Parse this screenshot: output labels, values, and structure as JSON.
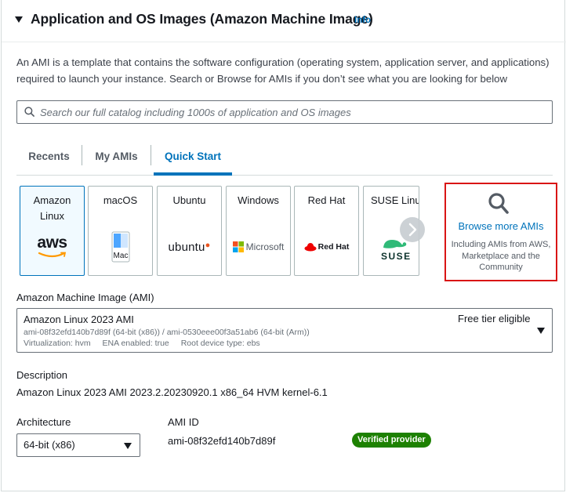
{
  "header": {
    "title": "Application and OS Images (Amazon Machine Image)",
    "info_label": "Info"
  },
  "description": "An AMI is a template that contains the software configuration (operating system, application server, and applications) required to launch your instance. Search or Browse for AMIs if you don’t see what you are looking for below",
  "search": {
    "placeholder": "Search our full catalog including 1000s of application and OS images"
  },
  "tabs": [
    {
      "label": "Recents",
      "active": false
    },
    {
      "label": "My AMIs",
      "active": false
    },
    {
      "label": "Quick Start",
      "active": true
    }
  ],
  "os_tiles": [
    {
      "label": "Amazon Linux",
      "logo_text": "aws",
      "selected": true
    },
    {
      "label": "macOS",
      "logo_text": "Mac",
      "selected": false
    },
    {
      "label": "Ubuntu",
      "logo_text": "ubuntu",
      "selected": false
    },
    {
      "label": "Windows",
      "logo_text": "Microsoft",
      "selected": false
    },
    {
      "label": "Red Hat",
      "logo_text": "Red Hat",
      "selected": false
    },
    {
      "label": "SUSE Linux",
      "logo_text": "SUSE",
      "selected": false
    }
  ],
  "browse": {
    "title": "Browse more AMIs",
    "subtitle": "Including AMIs from AWS, Marketplace and the Community"
  },
  "ami": {
    "label": "Amazon Machine Image (AMI)",
    "name": "Amazon Linux 2023 AMI",
    "ids": "ami-08f32efd140b7d89f (64-bit (x86)) / ami-0530eee00f3a51ab6 (64-bit (Arm))",
    "virtualization": "Virtualization: hvm",
    "ena": "ENA enabled: true",
    "root_device": "Root device type: ebs",
    "free_tier": "Free tier eligible"
  },
  "details": {
    "description_label": "Description",
    "description_value": "Amazon Linux 2023 AMI 2023.2.20230920.1 x86_64 HVM kernel-6.1",
    "architecture_label": "Architecture",
    "architecture_value": "64-bit (x86)",
    "ami_id_label": "AMI ID",
    "ami_id_value": "ami-08f32efd140b7d89f",
    "verified_badge": "Verified provider"
  },
  "colors": {
    "link_blue": "#0073bb",
    "highlight_red": "#d91515",
    "verified_green": "#1d8102"
  }
}
